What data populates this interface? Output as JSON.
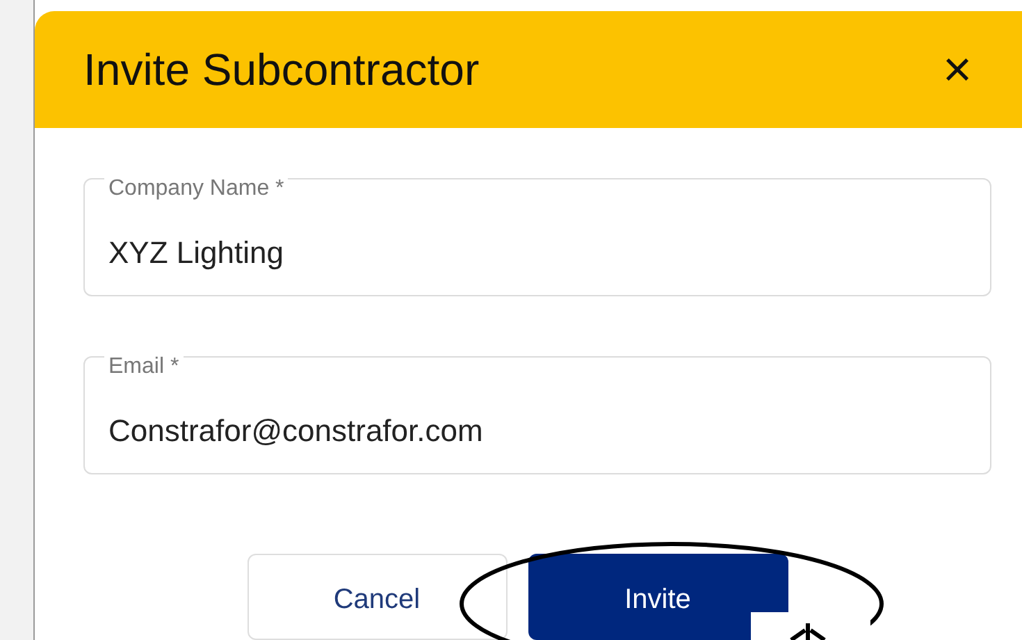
{
  "dialog": {
    "title": "Invite Subcontractor",
    "close": "×"
  },
  "fields": [
    {
      "label": "Company Name *",
      "value": "XYZ Lighting"
    },
    {
      "label": "Email *",
      "value": "Constrafor@constrafor.com"
    }
  ],
  "buttons": [
    {
      "label": "Cancel",
      "kind": "secondary"
    },
    {
      "label": "Invite",
      "kind": "primary"
    }
  ]
}
